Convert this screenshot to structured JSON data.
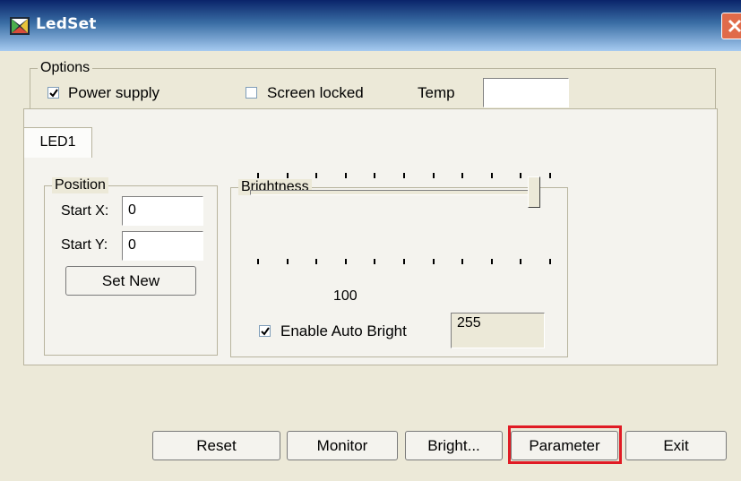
{
  "window": {
    "title": "LedSet",
    "icon": "app-logo-icon",
    "close_icon": "close-icon"
  },
  "options": {
    "title": "Options",
    "power_supply": {
      "label": "Power supply",
      "checked": true
    },
    "screen_locked": {
      "label": "Screen locked",
      "checked": false
    },
    "temp_label": "Temp",
    "temp_value": ""
  },
  "tabs": [
    {
      "label": "LED1",
      "selected": true
    }
  ],
  "position": {
    "title": "Position",
    "start_x_label": "Start X:",
    "start_x_value": "0",
    "start_y_label": "Start Y:",
    "start_y_value": "0",
    "set_new_label": "Set New"
  },
  "brightness": {
    "title": "Brightness",
    "slider_value": 100,
    "slider_value_text": "100",
    "slider_max": 100,
    "auto_bright": {
      "label": "Enable Auto Bright",
      "checked": true
    },
    "auto_bright_value": "255"
  },
  "footer_buttons": {
    "reset": "Reset",
    "monitor": "Monitor",
    "bright": "Bright...",
    "parameter": "Parameter",
    "exit": "Exit"
  },
  "highlight_color": "#e01b24"
}
